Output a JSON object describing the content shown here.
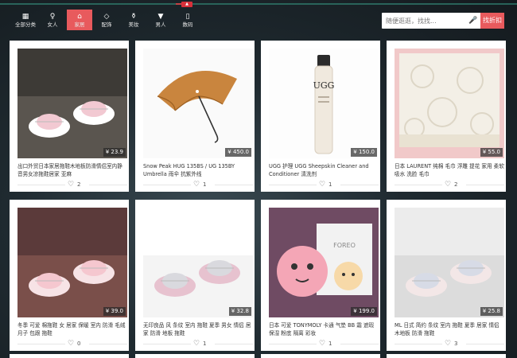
{
  "colors": {
    "accent": "#e85a5d",
    "nav_active": "#e85a5d"
  },
  "nav": [
    {
      "label": "全部分类",
      "icon": "grid-icon",
      "glyph": "▦",
      "active": false
    },
    {
      "label": "女人",
      "icon": "dress-icon",
      "glyph": "♀",
      "active": false
    },
    {
      "label": "家居",
      "icon": "home-icon",
      "glyph": "⌂",
      "active": true
    },
    {
      "label": "配饰",
      "icon": "accessory-icon",
      "glyph": "◇",
      "active": false
    },
    {
      "label": "美妆",
      "icon": "bag-icon",
      "glyph": "⚱",
      "active": false
    },
    {
      "label": "男人",
      "icon": "shirt-icon",
      "glyph": "▼",
      "active": false
    },
    {
      "label": "数码",
      "icon": "phone-icon",
      "glyph": "▯",
      "active": false
    }
  ],
  "search": {
    "placeholder": "随便逛逛，找找...",
    "button_label": "找折扣"
  },
  "products": [
    {
      "title": "出口外贸日本家居拖鞋木地板防滑情侣室内静音男女凉拖鞋居家 亚麻",
      "price": "¥ 23.9",
      "likes": "2",
      "image": "slippers-icon"
    },
    {
      "title": "Snow Peak HUG 135BS / UG 135BY Umbrella 雨伞 抗紫外线",
      "price": "¥ 450.0",
      "likes": "1",
      "image": "umbrella-icon"
    },
    {
      "title": "UGG 护理 UGG Sheepskin Cleaner and Conditioner 清洗剂",
      "price": "¥ 150.0",
      "likes": "1",
      "image": "bottle-icon"
    },
    {
      "title": "日本 LAURENT 纯棉 毛巾 浮雕 提花 家用 柔软 吸水 洗脸 毛巾",
      "price": "¥ 55.0",
      "likes": "2",
      "image": "towel-icon"
    },
    {
      "title": "冬季 可爱 棉拖鞋 女 居家 保暖 室内 防滑 毛绒 月子 包跟 拖鞋",
      "price": "¥ 39.0",
      "likes": "0",
      "image": "slippers-icon"
    },
    {
      "title": "无印良品 风 条纹 室内 拖鞋 夏季 男女 情侣 居家 防滑 地板 拖鞋",
      "price": "¥ 32.8",
      "likes": "1",
      "image": "slippers-icon"
    },
    {
      "title": "日本 可爱 TONYMOLY 卡通 气垫 BB 霜 遮瑕 保湿 粉底 隔离 彩妆",
      "price": "¥ 199.0",
      "likes": "1",
      "image": "compact-icon"
    },
    {
      "title": "ML 日式 简约 条纹 室内 拖鞋 夏季 居家 情侣 木地板 防滑 拖鞋",
      "price": "¥ 25.8",
      "likes": "3",
      "image": "slippers-icon"
    }
  ]
}
